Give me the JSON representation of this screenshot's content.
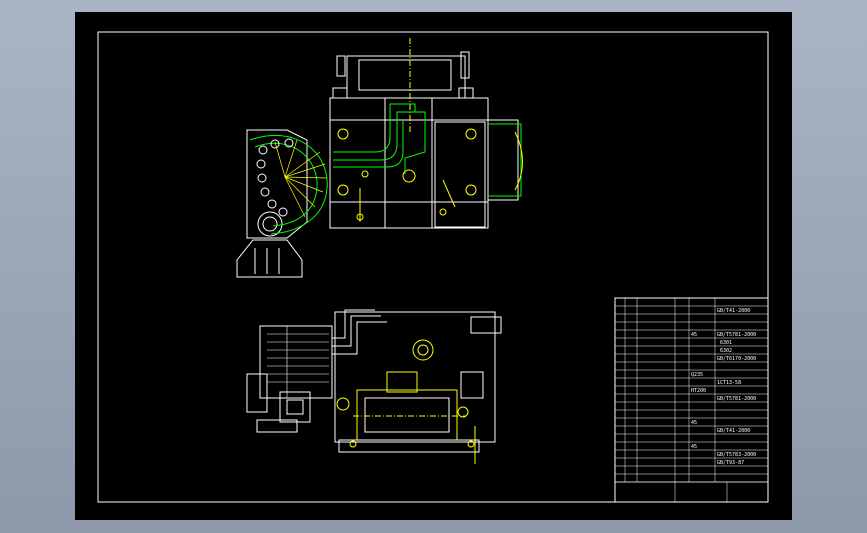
{
  "app": {
    "background_color": "#000000",
    "frame_color": "#ffffff"
  },
  "colors": {
    "outline": "#ffffff",
    "part": "#ffff00",
    "pipe": "#00ff00",
    "hidden": "#00ffff"
  },
  "bom": {
    "standards": [
      "GB/T41-2000",
      "GB/T5781-2000",
      "6301",
      "6302",
      "GB/T6170-2000",
      "1CT13-58",
      "GB/T5781-2000",
      "GB/T41-2000",
      "GB/T5783-2000",
      "GB/T93-87"
    ],
    "notes": [
      "45",
      "Q235",
      "HT200",
      "45",
      "45"
    ]
  }
}
